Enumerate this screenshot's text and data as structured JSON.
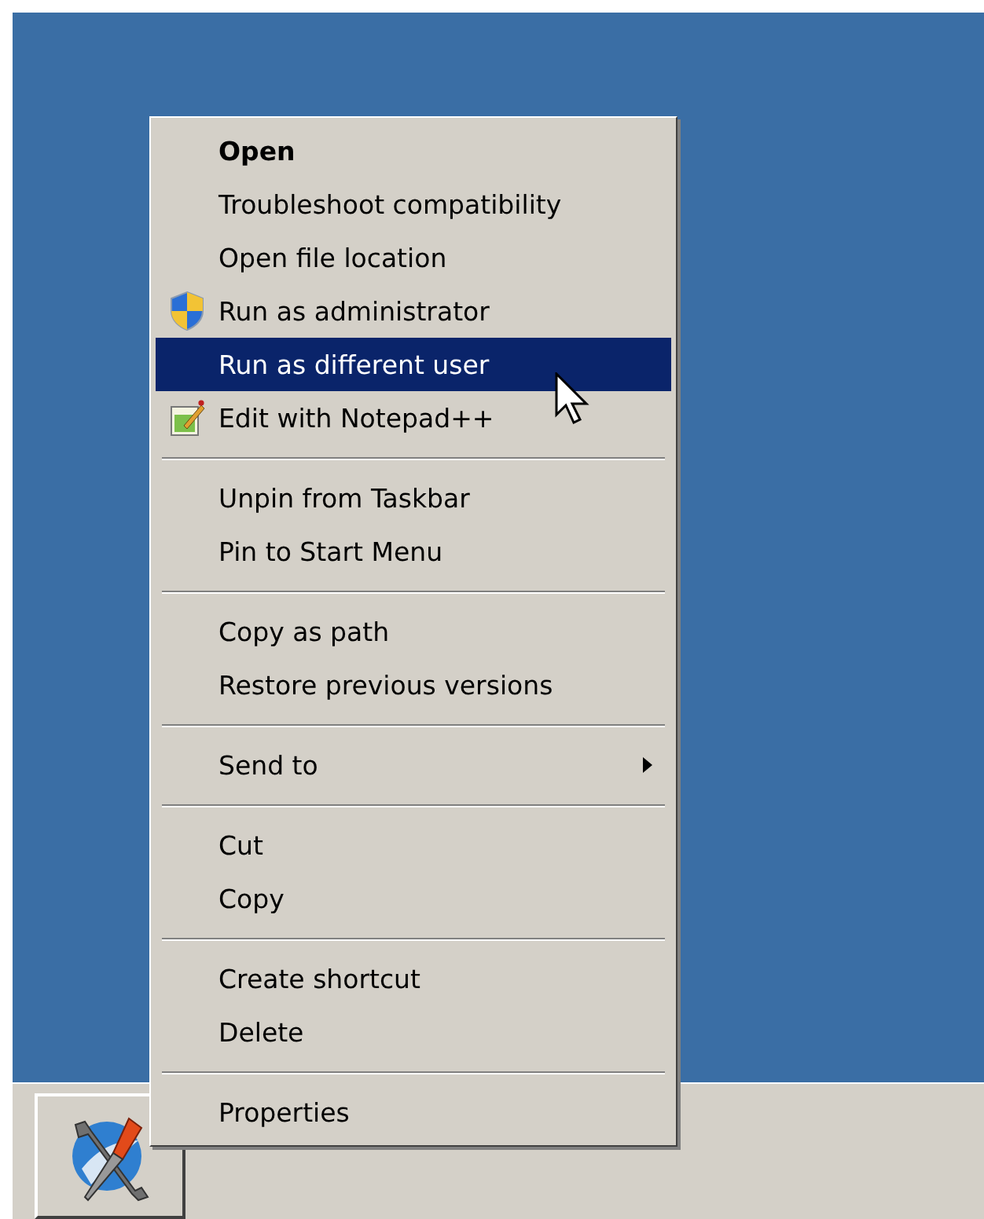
{
  "context_menu": {
    "items": [
      {
        "kind": "item",
        "label": "Open",
        "default": true,
        "selected": false
      },
      {
        "kind": "item",
        "label": "Troubleshoot compatibility",
        "default": false,
        "selected": false
      },
      {
        "kind": "item",
        "label": "Open file location",
        "default": false,
        "selected": false
      },
      {
        "kind": "shield",
        "label": "Run as administrator",
        "default": false,
        "selected": false
      },
      {
        "kind": "item",
        "label": "Run as different user",
        "default": false,
        "selected": true
      },
      {
        "kind": "editor",
        "label": "Edit with Notepad++",
        "default": false,
        "selected": false
      },
      {
        "kind": "separator"
      },
      {
        "kind": "item",
        "label": "Unpin from Taskbar",
        "default": false,
        "selected": false
      },
      {
        "kind": "item",
        "label": "Pin to Start Menu",
        "default": false,
        "selected": false
      },
      {
        "kind": "separator"
      },
      {
        "kind": "item",
        "label": "Copy as path",
        "default": false,
        "selected": false
      },
      {
        "kind": "item",
        "label": "Restore previous versions",
        "default": false,
        "selected": false
      },
      {
        "kind": "separator"
      },
      {
        "kind": "submenu",
        "label": "Send to",
        "default": false,
        "selected": false
      },
      {
        "kind": "separator"
      },
      {
        "kind": "item",
        "label": "Cut",
        "default": false,
        "selected": false
      },
      {
        "kind": "item",
        "label": "Copy",
        "default": false,
        "selected": false
      },
      {
        "kind": "separator"
      },
      {
        "kind": "item",
        "label": "Create shortcut",
        "default": false,
        "selected": false
      },
      {
        "kind": "item",
        "label": "Delete",
        "default": false,
        "selected": false
      },
      {
        "kind": "separator"
      },
      {
        "kind": "item",
        "label": "Properties",
        "default": false,
        "selected": false
      }
    ]
  }
}
